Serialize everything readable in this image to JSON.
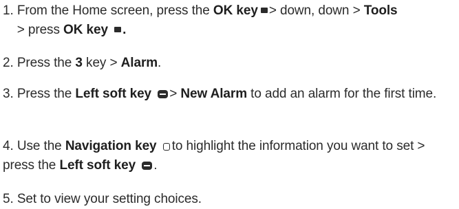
{
  "steps": [
    {
      "number": "1.",
      "t1": "From the Home screen, press the ",
      "b1": "OK key",
      "t2": "> down, down > ",
      "b2": "Tools",
      "t3": "> press ",
      "b3": "OK key",
      "t4": "."
    },
    {
      "number": "2.",
      "t1": "Press the ",
      "b1": "3",
      "t2": " key > ",
      "b2": "Alarm",
      "t3": "."
    },
    {
      "number": "3.",
      "t1": "Press the ",
      "b1": "Left soft key",
      "t2": "> ",
      "b2": "New Alarm",
      "t3": " to add an alarm for the first time."
    },
    {
      "number": "4.",
      "t1": "Use the ",
      "b1": "Navigation key",
      "t2": "to highlight the information you want to set > press the ",
      "b2": "Left soft key",
      "t3": "."
    },
    {
      "number": "5.",
      "t1": "Set to view your setting choices."
    }
  ],
  "icons": {
    "ok_key": "ok-key-icon",
    "left_soft_key": "left-soft-key-icon",
    "navigation_key": "navigation-key-icon"
  }
}
